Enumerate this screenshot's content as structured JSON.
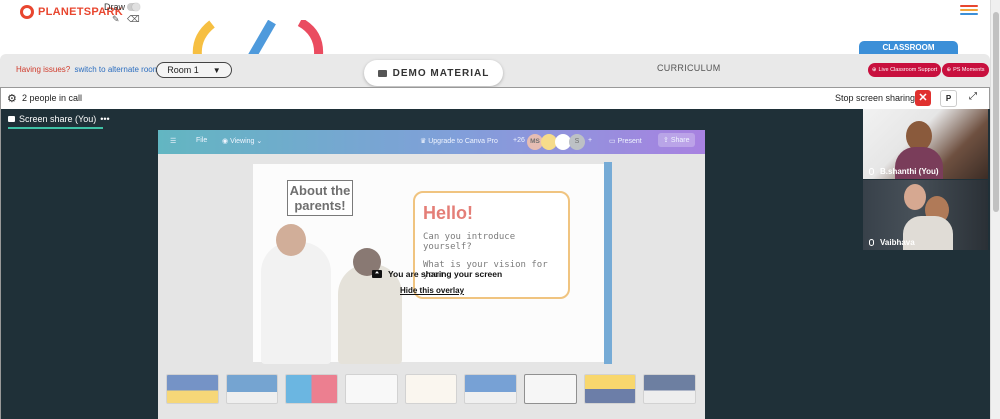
{
  "app": {
    "logo_text": "PLANETSPARK"
  },
  "toolbar": {
    "draw_label": "Draw",
    "pencil_icon": "pencil-icon",
    "eraser_icon": "eraser-icon"
  },
  "roombar": {
    "issue_text": "Having issues?",
    "alt_room_link": "switch to alternate room",
    "room_selected": "Room 1",
    "demo_material": "DEMO MATERIAL",
    "curriculum": "CURRICULUM",
    "classroom_tab": "CLASSROOM",
    "live_support": "Live Classroom Support",
    "ps_moments": "PS Moments"
  },
  "callbar": {
    "people": "2 people in call",
    "stop_share": "Stop screen sharing",
    "p_button": "P"
  },
  "stage": {
    "tab_label": "Screen share (You)",
    "tab_more": "•••"
  },
  "canva": {
    "file": "File",
    "viewing": "Viewing",
    "upgrade": "Upgrade to Canva Pro",
    "count": "+26",
    "avatar_initials": "MS",
    "avatar_s": "S",
    "present": "Present",
    "share": "Share",
    "about_title": "About the parents!",
    "hello": "Hello!",
    "q1": "Can you introduce yourself?",
    "q2": "What is your vision for your"
  },
  "overlay": {
    "message": "You are sharing your screen",
    "hide": "Hide this overlay"
  },
  "participants": [
    {
      "name": "B.shanthi (You)"
    },
    {
      "name": "Vaibhava"
    }
  ],
  "colors": {
    "accent_red": "#c8103e",
    "classroom_blue": "#3b8fd8",
    "stage_bg": "#1f3038",
    "tab_underline": "#3fc1a6"
  }
}
